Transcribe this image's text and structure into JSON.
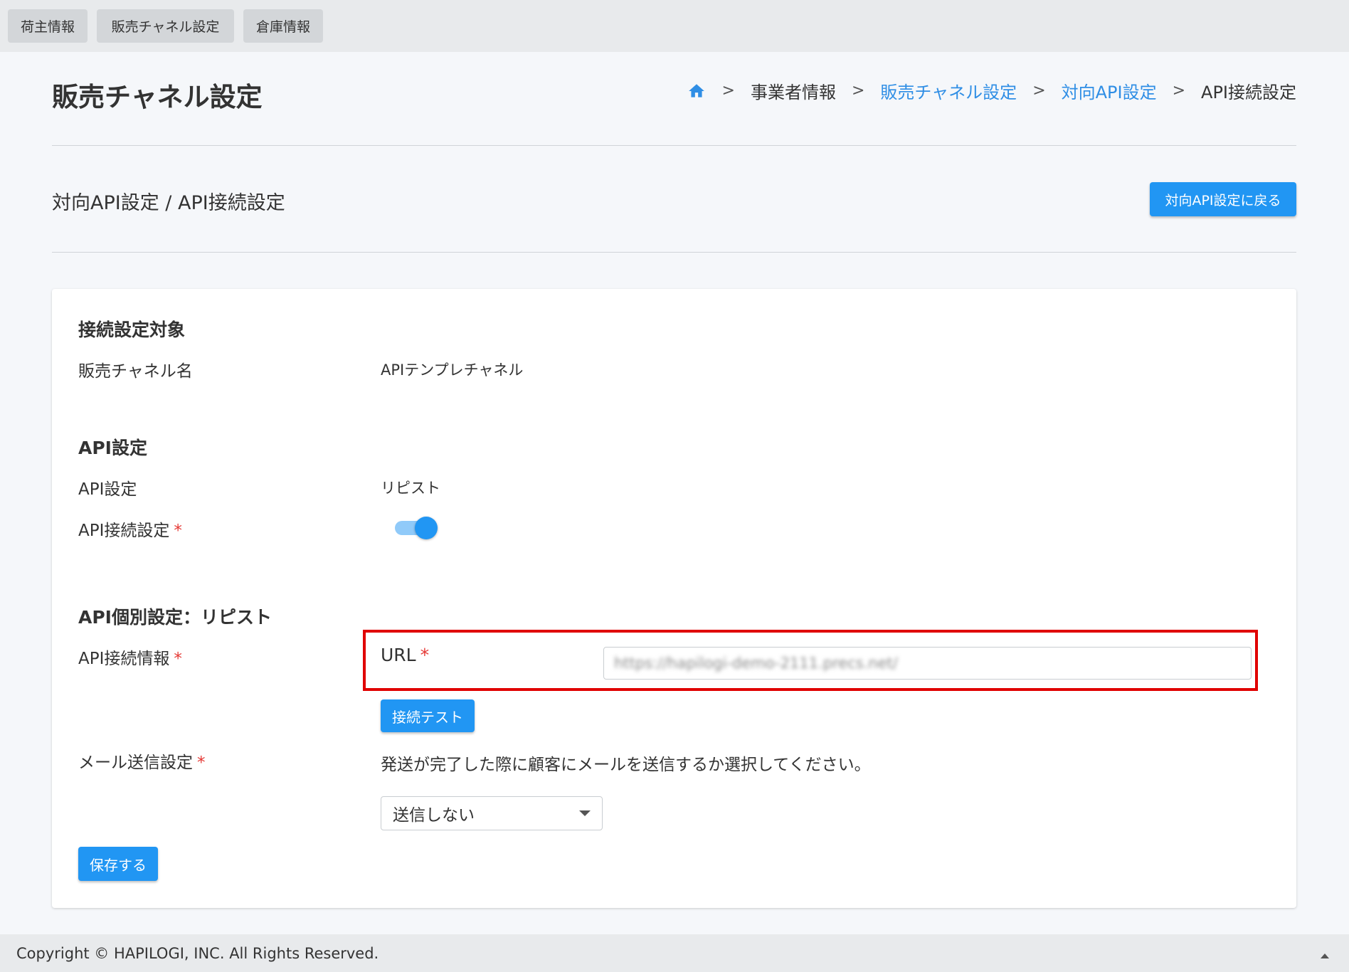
{
  "top_tabs": [
    {
      "label": "荷主情報"
    },
    {
      "label": "販売チャネル設定"
    },
    {
      "label": "倉庫情報"
    }
  ],
  "page_title": "販売チャネル設定",
  "breadcrumb": {
    "home_icon": "home-icon",
    "items": [
      {
        "label": "事業者情報"
      },
      {
        "label": "販売チャネル設定"
      },
      {
        "label": "対向API設定"
      },
      {
        "label": "API接続設定"
      }
    ],
    "separator": ">"
  },
  "subtitle": "対向API設定 / API接続設定",
  "back_button": "対向API設定に戻る",
  "sections": {
    "target": {
      "title": "接続設定対象",
      "channel_name_label": "販売チャネル名",
      "channel_name_value": "APIテンプレチャネル"
    },
    "api": {
      "title": "API設定",
      "api_label": "API設定",
      "api_value": "リピスト",
      "connection_label": "API接続設定",
      "connection_enabled": true
    },
    "individual": {
      "title": "API個別設定：リピスト",
      "info_label": "API接続情報",
      "url_label": "URL",
      "url_value": "https://hapilogi-demo-2111.precs.net/",
      "test_button": "接続テスト",
      "mail_label": "メール送信設定",
      "mail_desc": "発送が完了した際に顧客にメールを送信するか選択してください。",
      "mail_selected": "送信しない"
    }
  },
  "required_mark": "*",
  "save_button": "保存する",
  "footer": "Copyright © HAPILOGI, INC. All Rights Reserved.",
  "colors": {
    "accent": "#2196f3",
    "highlight": "#e00000",
    "required": "#e53935"
  }
}
